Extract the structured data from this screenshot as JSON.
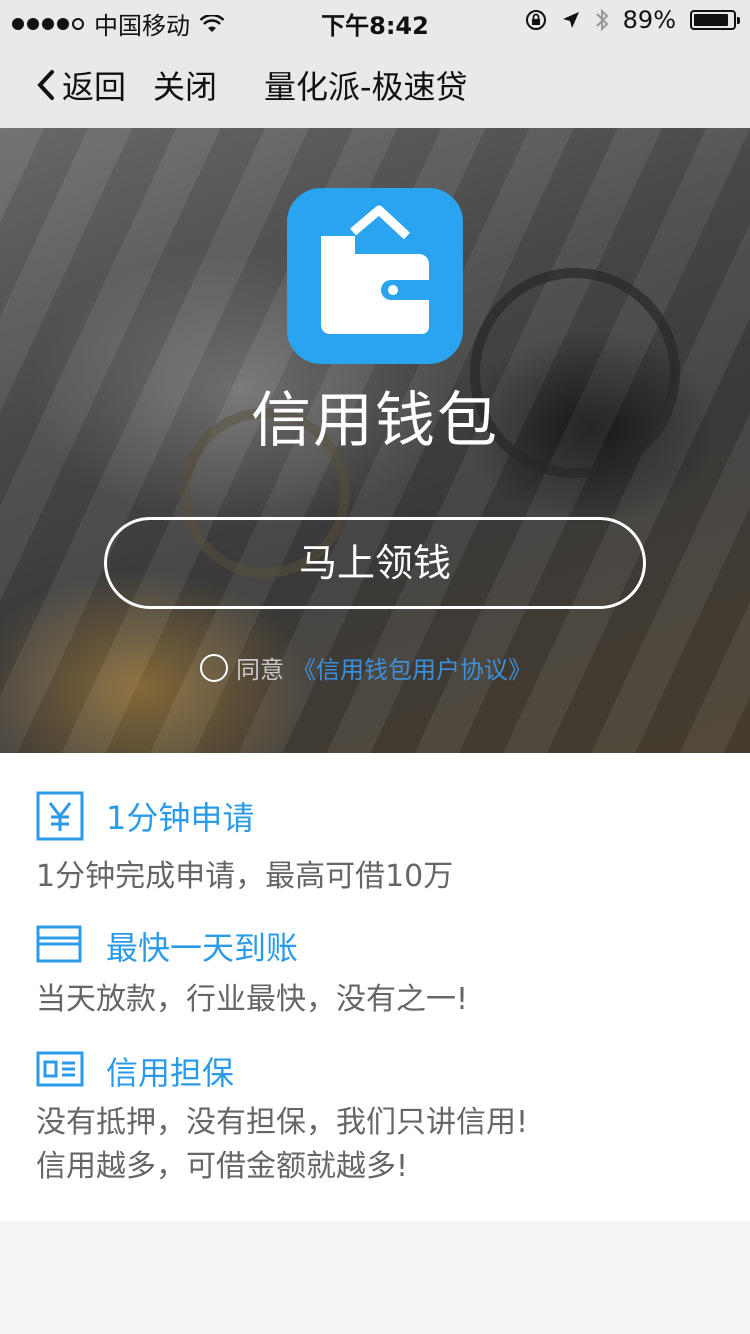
{
  "status_bar": {
    "carrier": "中国移动",
    "time": "下午8:42",
    "battery": "89%",
    "battery_level": 0.89
  },
  "nav": {
    "back_label": "返回",
    "close_label": "关闭",
    "title": "量化派-极速贷"
  },
  "hero": {
    "app_name": "信用钱包",
    "cta_label": "马上领钱",
    "agree_text": "同意",
    "agreement_link": "《信用钱包用户协议》"
  },
  "features": [
    {
      "icon": "yuan-icon",
      "title": "1分钟申请",
      "desc": [
        "1分钟完成申请，最高可借10万"
      ]
    },
    {
      "icon": "card-icon",
      "title": "最快一天到账",
      "desc": [
        "当天放款，行业最快，没有之一!"
      ]
    },
    {
      "icon": "id-card-icon",
      "title": "信用担保",
      "desc": [
        "没有抵押，没有担保，我们只讲信用!",
        "信用越多，可借金额就越多!"
      ]
    }
  ],
  "colors": {
    "accent": "#2b9be8",
    "app_icon_bg": "#2aa4ee",
    "link": "#3e8fd9"
  }
}
